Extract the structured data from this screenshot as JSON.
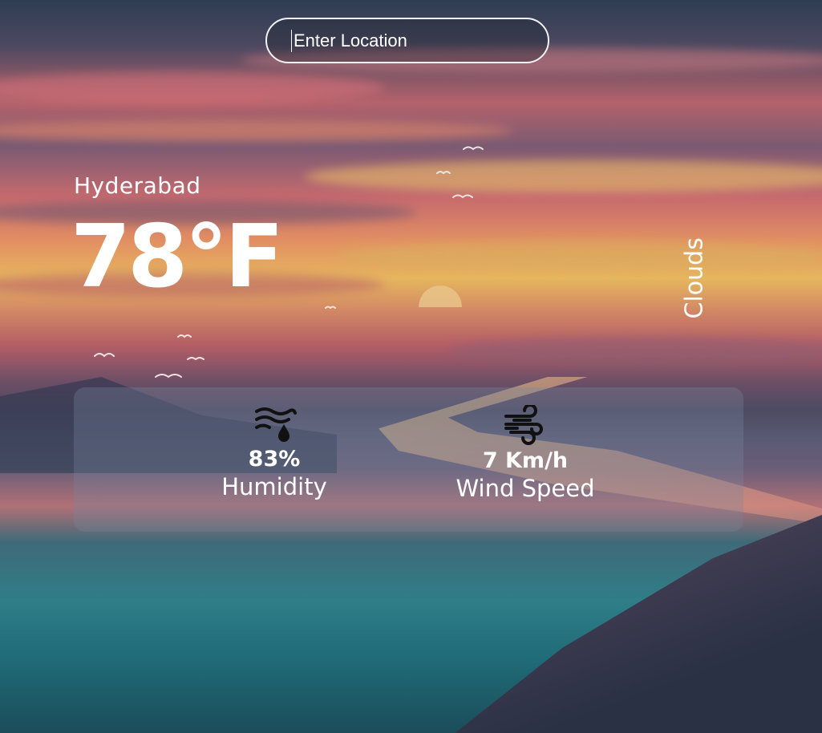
{
  "search": {
    "placeholder": "Enter Location"
  },
  "weather": {
    "city": "Hyderabad",
    "temperature": "78°F",
    "condition": "Clouds"
  },
  "stats": {
    "humidity": {
      "value": "83%",
      "label": "Humidity",
      "icon": "humidity-icon"
    },
    "wind": {
      "value": "7 Km/h",
      "label": "Wind Speed",
      "icon": "wind-icon"
    }
  },
  "colors": {
    "text": "#ffffff",
    "icon": "#111111",
    "panel": "rgba(120,135,160,0.32)"
  }
}
